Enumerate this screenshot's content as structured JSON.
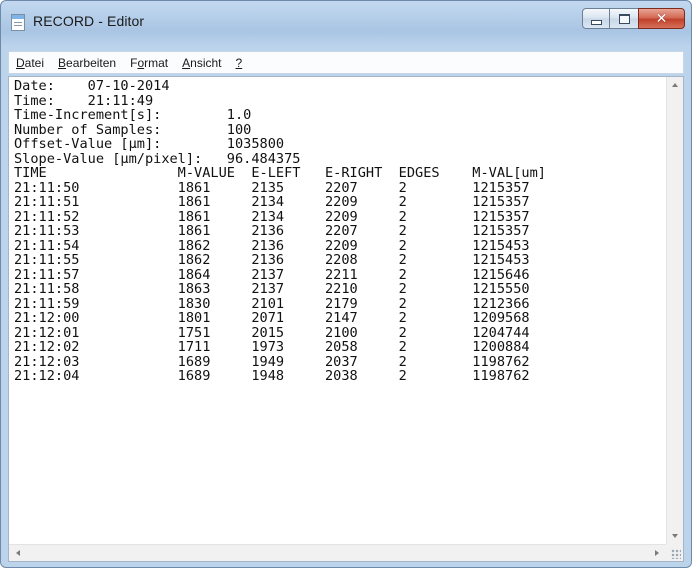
{
  "window": {
    "title": "RECORD - Editor"
  },
  "menu": [
    {
      "label": "Datei"
    },
    {
      "label": "Bearbeiten"
    },
    {
      "label": "Format"
    },
    {
      "label": "Ansicht"
    },
    {
      "label": "?"
    }
  ],
  "document": {
    "lines": [
      "Date:    07-10-2014",
      "Time:    21:11:49",
      "Time-Increment[s]:        1.0",
      "Number of Samples:        100",
      "Offset-Value [µm]:        1035800",
      "Slope-Value [µm/pixel]:   96.484375",
      "TIME                M-VALUE  E-LEFT   E-RIGHT  EDGES    M-VAL[um]",
      "21:11:50            1861     2135     2207     2        1215357",
      "21:11:51            1861     2134     2209     2        1215357",
      "21:11:52            1861     2134     2209     2        1215357",
      "21:11:53            1861     2136     2207     2        1215357",
      "21:11:54            1862     2136     2209     2        1215453",
      "21:11:55            1862     2136     2208     2        1215453",
      "21:11:57            1864     2137     2211     2        1215646",
      "21:11:58            1863     2137     2210     2        1215550",
      "21:11:59            1830     2101     2179     2        1212366",
      "21:12:00            1801     2071     2147     2        1209568",
      "21:12:01            1751     2015     2100     2        1204744",
      "21:12:02            1711     1973     2058     2        1200884",
      "21:12:03            1689     1949     2037     2        1198762",
      "21:12:04            1689     1948     2038     2        1198762"
    ]
  }
}
